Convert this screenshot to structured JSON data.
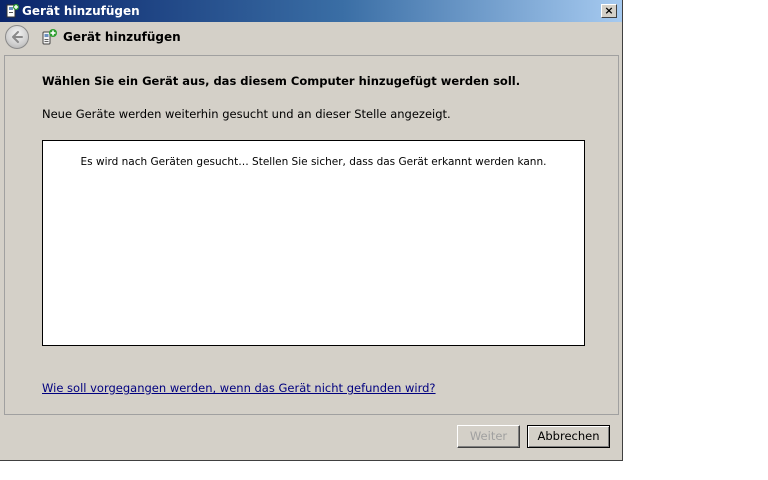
{
  "window": {
    "title": "Gerät hinzufügen",
    "close_label": "×"
  },
  "nav": {
    "title": "Gerät hinzufügen"
  },
  "content": {
    "heading": "Wählen Sie ein Gerät aus, das diesem Computer hinzugefügt werden soll.",
    "subtext": "Neue Geräte werden weiterhin gesucht und an dieser Stelle angezeigt.",
    "device_list_status": "Es wird nach Geräten gesucht… Stellen Sie sicher, dass das Gerät erkannt werden kann.",
    "help_link": "Wie soll vorgegangen werden, wenn das Gerät nicht gefunden wird?"
  },
  "buttons": {
    "next_label": "Weiter",
    "next_enabled": false,
    "cancel_label": "Abbrechen"
  },
  "colors": {
    "title_bar_start": "#0a246a",
    "dialog_background": "#d4d0c8",
    "link": "#00007f"
  }
}
